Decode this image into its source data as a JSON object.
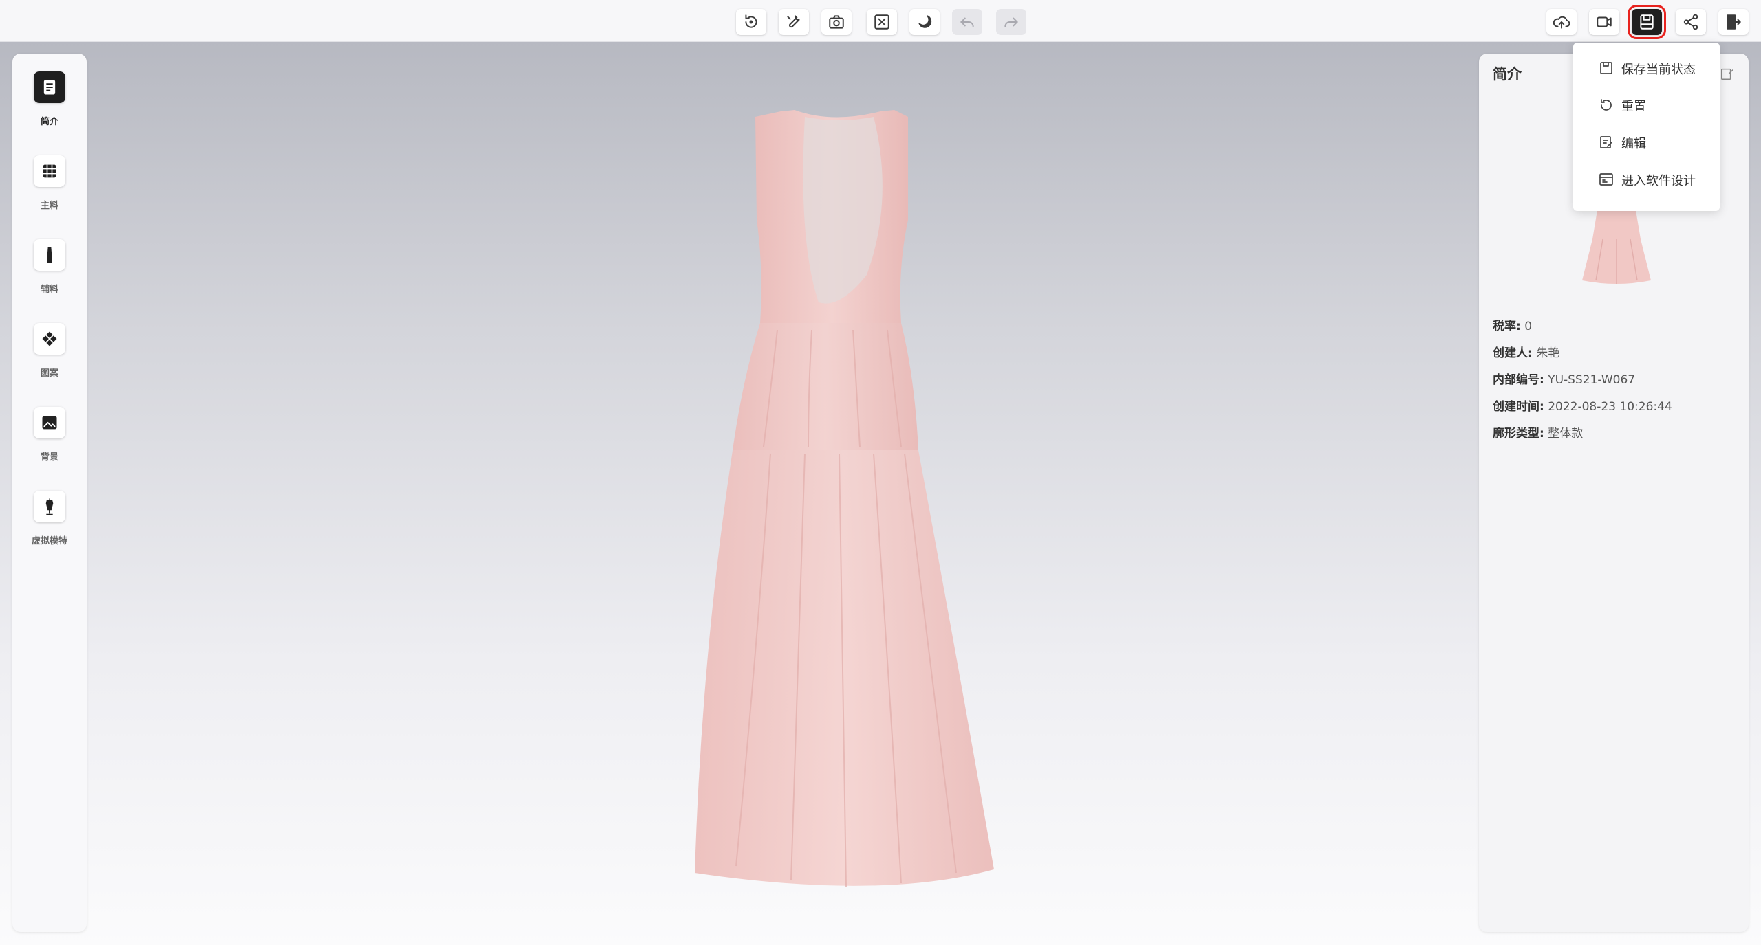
{
  "toolbar": {
    "center_buttons": [
      {
        "name": "rotate-button",
        "icon": "rotate-icon"
      },
      {
        "name": "tools-button",
        "icon": "wrench-icon"
      },
      {
        "name": "screenshot-button",
        "icon": "camera-icon"
      },
      {
        "name": "fullscreen-button",
        "icon": "expand-icon"
      },
      {
        "name": "night-mode-button",
        "icon": "moon-icon"
      },
      {
        "name": "undo-button",
        "icon": "undo-icon",
        "disabled": true
      },
      {
        "name": "redo-button",
        "icon": "redo-icon",
        "disabled": true
      }
    ],
    "right_buttons": [
      {
        "name": "upload-button",
        "icon": "cloud-upload-icon"
      },
      {
        "name": "video-button",
        "icon": "video-camera-icon"
      },
      {
        "name": "save-menu-button",
        "icon": "save-state-icon",
        "active": true
      },
      {
        "name": "share-button",
        "icon": "share-icon"
      },
      {
        "name": "exit-button",
        "icon": "exit-door-icon"
      }
    ]
  },
  "sidebar": {
    "items": [
      {
        "label": "简介",
        "icon": "document-icon",
        "active": true
      },
      {
        "label": "主料",
        "icon": "fabric-grid-icon"
      },
      {
        "label": "辅料",
        "icon": "zipper-icon"
      },
      {
        "label": "图案",
        "icon": "pattern-icon"
      },
      {
        "label": "背景",
        "icon": "background-image-icon"
      },
      {
        "label": "虚拟模特",
        "icon": "mannequin-icon"
      }
    ]
  },
  "panel": {
    "title": "简介",
    "info": [
      {
        "label": "税率:",
        "value": "0"
      },
      {
        "label": "创建人:",
        "value": "朱艳"
      },
      {
        "label": "内部编号:",
        "value": "YU-SS21-W067"
      },
      {
        "label": "创建时间:",
        "value": "2022-08-23 10:26:44"
      },
      {
        "label": "廓形类型:",
        "value": "整体款"
      }
    ]
  },
  "dropdown": {
    "items": [
      {
        "label": "保存当前状态",
        "icon": "save-icon"
      },
      {
        "label": "重置",
        "icon": "reset-icon"
      },
      {
        "label": "编辑",
        "icon": "edit-icon"
      },
      {
        "label": "进入软件设计",
        "icon": "software-design-icon"
      }
    ]
  },
  "colors": {
    "accent_highlight": "#e8231f",
    "dress": "#f3c9c6"
  }
}
